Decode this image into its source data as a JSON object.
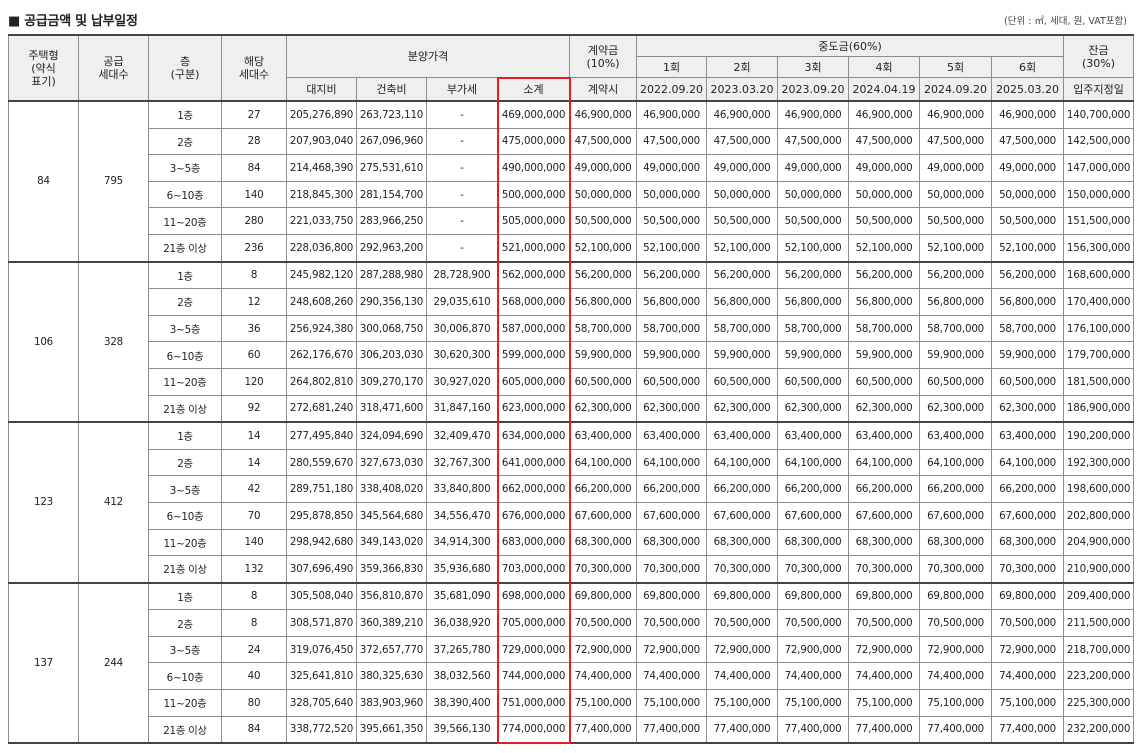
{
  "header": {
    "title": "■  공급금액 및 납부일정",
    "unit_note": "(단위 : ㎡, 세대, 원, VAT포함)"
  },
  "columns": {
    "type": "주택형 (약식 표기)",
    "type_lines": [
      "주택형",
      "(약식",
      "표기)"
    ],
    "supply_lines": [
      "공급",
      "세대수"
    ],
    "floor_lines": [
      "층",
      "(구분)"
    ],
    "units_lines": [
      "해당",
      "세대수"
    ],
    "price_group": "분양가격",
    "land": "대지비",
    "building": "건축비",
    "vat": "부가세",
    "subtotal": "소계",
    "deposit_lines": [
      "계약금",
      "(10%)"
    ],
    "deposit_when": "계약시",
    "middle_group": "중도금(60%)",
    "middle_rounds": [
      "1회",
      "2회",
      "3회",
      "4회",
      "5회",
      "6회"
    ],
    "middle_dates": [
      "2022.09.20",
      "2023.03.20",
      "2023.09.20",
      "2024.04.19",
      "2024.09.20",
      "2025.03.20"
    ],
    "balance_lines": [
      "잔금",
      "(30%)"
    ],
    "balance_when": "입주지정일"
  },
  "groups": [
    {
      "type": "84",
      "supply": "795",
      "rows": [
        {
          "floor": "1층",
          "units": "27",
          "land": "205,276,890",
          "build": "263,723,110",
          "vat": "-",
          "subtotal": "469,000,000",
          "deposit": "46,900,000",
          "mid": "46,900,000",
          "balance": "140,700,000"
        },
        {
          "floor": "2층",
          "units": "28",
          "land": "207,903,040",
          "build": "267,096,960",
          "vat": "-",
          "subtotal": "475,000,000",
          "deposit": "47,500,000",
          "mid": "47,500,000",
          "balance": "142,500,000"
        },
        {
          "floor": "3~5층",
          "units": "84",
          "land": "214,468,390",
          "build": "275,531,610",
          "vat": "-",
          "subtotal": "490,000,000",
          "deposit": "49,000,000",
          "mid": "49,000,000",
          "balance": "147,000,000"
        },
        {
          "floor": "6~10층",
          "units": "140",
          "land": "218,845,300",
          "build": "281,154,700",
          "vat": "-",
          "subtotal": "500,000,000",
          "deposit": "50,000,000",
          "mid": "50,000,000",
          "balance": "150,000,000"
        },
        {
          "floor": "11~20층",
          "units": "280",
          "land": "221,033,750",
          "build": "283,966,250",
          "vat": "-",
          "subtotal": "505,000,000",
          "deposit": "50,500,000",
          "mid": "50,500,000",
          "balance": "151,500,000"
        },
        {
          "floor": "21층 이상",
          "units": "236",
          "land": "228,036,800",
          "build": "292,963,200",
          "vat": "-",
          "subtotal": "521,000,000",
          "deposit": "52,100,000",
          "mid": "52,100,000",
          "balance": "156,300,000"
        }
      ]
    },
    {
      "type": "106",
      "supply": "328",
      "rows": [
        {
          "floor": "1층",
          "units": "8",
          "land": "245,982,120",
          "build": "287,288,980",
          "vat": "28,728,900",
          "subtotal": "562,000,000",
          "deposit": "56,200,000",
          "mid": "56,200,000",
          "balance": "168,600,000"
        },
        {
          "floor": "2층",
          "units": "12",
          "land": "248,608,260",
          "build": "290,356,130",
          "vat": "29,035,610",
          "subtotal": "568,000,000",
          "deposit": "56,800,000",
          "mid": "56,800,000",
          "balance": "170,400,000"
        },
        {
          "floor": "3~5층",
          "units": "36",
          "land": "256,924,380",
          "build": "300,068,750",
          "vat": "30,006,870",
          "subtotal": "587,000,000",
          "deposit": "58,700,000",
          "mid": "58,700,000",
          "balance": "176,100,000"
        },
        {
          "floor": "6~10층",
          "units": "60",
          "land": "262,176,670",
          "build": "306,203,030",
          "vat": "30,620,300",
          "subtotal": "599,000,000",
          "deposit": "59,900,000",
          "mid": "59,900,000",
          "balance": "179,700,000"
        },
        {
          "floor": "11~20층",
          "units": "120",
          "land": "264,802,810",
          "build": "309,270,170",
          "vat": "30,927,020",
          "subtotal": "605,000,000",
          "deposit": "60,500,000",
          "mid": "60,500,000",
          "balance": "181,500,000"
        },
        {
          "floor": "21층 이상",
          "units": "92",
          "land": "272,681,240",
          "build": "318,471,600",
          "vat": "31,847,160",
          "subtotal": "623,000,000",
          "deposit": "62,300,000",
          "mid": "62,300,000",
          "balance": "186,900,000"
        }
      ]
    },
    {
      "type": "123",
      "supply": "412",
      "rows": [
        {
          "floor": "1층",
          "units": "14",
          "land": "277,495,840",
          "build": "324,094,690",
          "vat": "32,409,470",
          "subtotal": "634,000,000",
          "deposit": "63,400,000",
          "mid": "63,400,000",
          "balance": "190,200,000"
        },
        {
          "floor": "2층",
          "units": "14",
          "land": "280,559,670",
          "build": "327,673,030",
          "vat": "32,767,300",
          "subtotal": "641,000,000",
          "deposit": "64,100,000",
          "mid": "64,100,000",
          "balance": "192,300,000"
        },
        {
          "floor": "3~5층",
          "units": "42",
          "land": "289,751,180",
          "build": "338,408,020",
          "vat": "33,840,800",
          "subtotal": "662,000,000",
          "deposit": "66,200,000",
          "mid": "66,200,000",
          "balance": "198,600,000"
        },
        {
          "floor": "6~10층",
          "units": "70",
          "land": "295,878,850",
          "build": "345,564,680",
          "vat": "34,556,470",
          "subtotal": "676,000,000",
          "deposit": "67,600,000",
          "mid": "67,600,000",
          "balance": "202,800,000"
        },
        {
          "floor": "11~20층",
          "units": "140",
          "land": "298,942,680",
          "build": "349,143,020",
          "vat": "34,914,300",
          "subtotal": "683,000,000",
          "deposit": "68,300,000",
          "mid": "68,300,000",
          "balance": "204,900,000"
        },
        {
          "floor": "21층 이상",
          "units": "132",
          "land": "307,696,490",
          "build": "359,366,830",
          "vat": "35,936,680",
          "subtotal": "703,000,000",
          "deposit": "70,300,000",
          "mid": "70,300,000",
          "balance": "210,900,000"
        }
      ]
    },
    {
      "type": "137",
      "supply": "244",
      "rows": [
        {
          "floor": "1층",
          "units": "8",
          "land": "305,508,040",
          "build": "356,810,870",
          "vat": "35,681,090",
          "subtotal": "698,000,000",
          "deposit": "69,800,000",
          "mid": "69,800,000",
          "balance": "209,400,000"
        },
        {
          "floor": "2층",
          "units": "8",
          "land": "308,571,870",
          "build": "360,389,210",
          "vat": "36,038,920",
          "subtotal": "705,000,000",
          "deposit": "70,500,000",
          "mid": "70,500,000",
          "balance": "211,500,000"
        },
        {
          "floor": "3~5층",
          "units": "24",
          "land": "319,076,450",
          "build": "372,657,770",
          "vat": "37,265,780",
          "subtotal": "729,000,000",
          "deposit": "72,900,000",
          "mid": "72,900,000",
          "balance": "218,700,000"
        },
        {
          "floor": "6~10층",
          "units": "40",
          "land": "325,641,810",
          "build": "380,325,630",
          "vat": "38,032,560",
          "subtotal": "744,000,000",
          "deposit": "74,400,000",
          "mid": "74,400,000",
          "balance": "223,200,000"
        },
        {
          "floor": "11~20층",
          "units": "80",
          "land": "328,705,640",
          "build": "383,903,960",
          "vat": "38,390,400",
          "subtotal": "751,000,000",
          "deposit": "75,100,000",
          "mid": "75,100,000",
          "balance": "225,300,000"
        },
        {
          "floor": "21층 이상",
          "units": "84",
          "land": "338,772,520",
          "build": "395,661,350",
          "vat": "39,566,130",
          "subtotal": "774,000,000",
          "deposit": "77,400,000",
          "mid": "77,400,000",
          "balance": "232,200,000"
        }
      ]
    }
  ],
  "colors": {
    "highlight": "#e51c23",
    "header_bg": "#efefef",
    "border": "#8c8c8c"
  }
}
